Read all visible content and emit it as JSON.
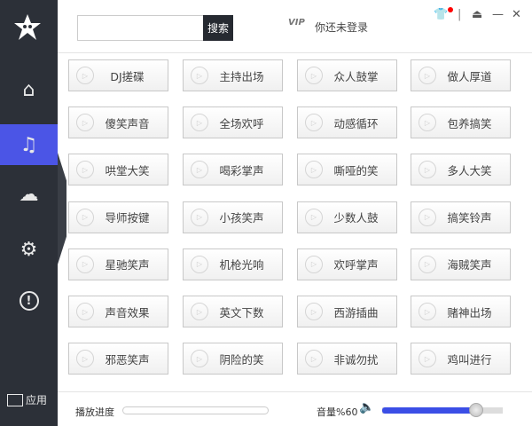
{
  "sidebar": {
    "items": [
      {
        "icon": "home-icon",
        "glyph": "⌂"
      },
      {
        "icon": "music-file-icon",
        "glyph": "♫"
      },
      {
        "icon": "cloud-icon",
        "glyph": "☁"
      },
      {
        "icon": "gear-icon",
        "glyph": "⚙"
      },
      {
        "icon": "alert-icon",
        "glyph": "!"
      }
    ],
    "app_label": "应用"
  },
  "header": {
    "search_placeholder": "",
    "search_button": "搜索",
    "vip_badge": "VIP",
    "login_status": "你还未登录"
  },
  "sounds": [
    [
      "DJ搓碟",
      "主持出场",
      "众人鼓掌",
      "做人厚道"
    ],
    [
      "傻笑声音",
      "全场欢呼",
      "动感循环",
      "包养搞笑"
    ],
    [
      "哄堂大笑",
      "喝彩掌声",
      "嘶哑的笑",
      "多人大笑"
    ],
    [
      "导师按键",
      "小孩笑声",
      "少数人鼓",
      "搞笑铃声"
    ],
    [
      "星驰笑声",
      "机枪光响",
      "欢呼掌声",
      "海贼笑声"
    ],
    [
      "声音效果",
      "英文下数",
      "西游插曲",
      "赌神出场"
    ],
    [
      "邪恶笑声",
      "阴险的笑",
      "非诚勿扰",
      "鸡叫进行"
    ]
  ],
  "footer": {
    "progress_label": "播放进度",
    "progress": 0,
    "volume_label": "音量%60",
    "volume": 0.78
  },
  "colors": {
    "accent": "#4b55e6",
    "sidebar": "#2c3038"
  }
}
